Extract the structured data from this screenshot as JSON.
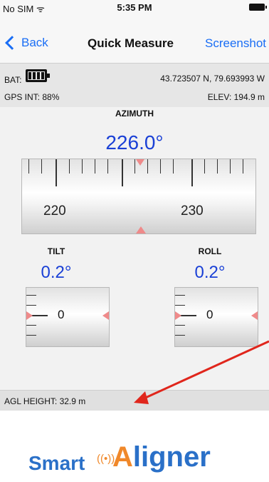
{
  "status": {
    "carrier": "No SIM ᯤ",
    "time": "5:35 PM"
  },
  "nav": {
    "back_label": "Back",
    "title": "Quick Measure",
    "screenshot_label": "Screenshot"
  },
  "info": {
    "bat_label": "BAT:",
    "coordinates": "43.723507 N, 79.693993 W",
    "gps_int": "GPS INT: 88%",
    "elevation": "ELEV: 194.9 m"
  },
  "azimuth": {
    "label": "AZIMUTH",
    "value": "226.0°",
    "scale_labels": [
      "220",
      "230"
    ]
  },
  "tilt": {
    "label": "TILT",
    "value": "0.2°",
    "gauge_label": "0"
  },
  "roll": {
    "label": "ROLL",
    "value": "0.2°",
    "gauge_label": "0"
  },
  "agl": {
    "label": "AGL HEIGHT: 32.9 m"
  },
  "logo": {
    "part1": "Smart",
    "part2_accent": "A",
    "part2_rest": "ligner"
  },
  "colors": {
    "accent": "#1a6ef5",
    "value_blue": "#1a40d6",
    "pointer": "#ef8a8a",
    "annotation_arrow": "#e0261c"
  }
}
